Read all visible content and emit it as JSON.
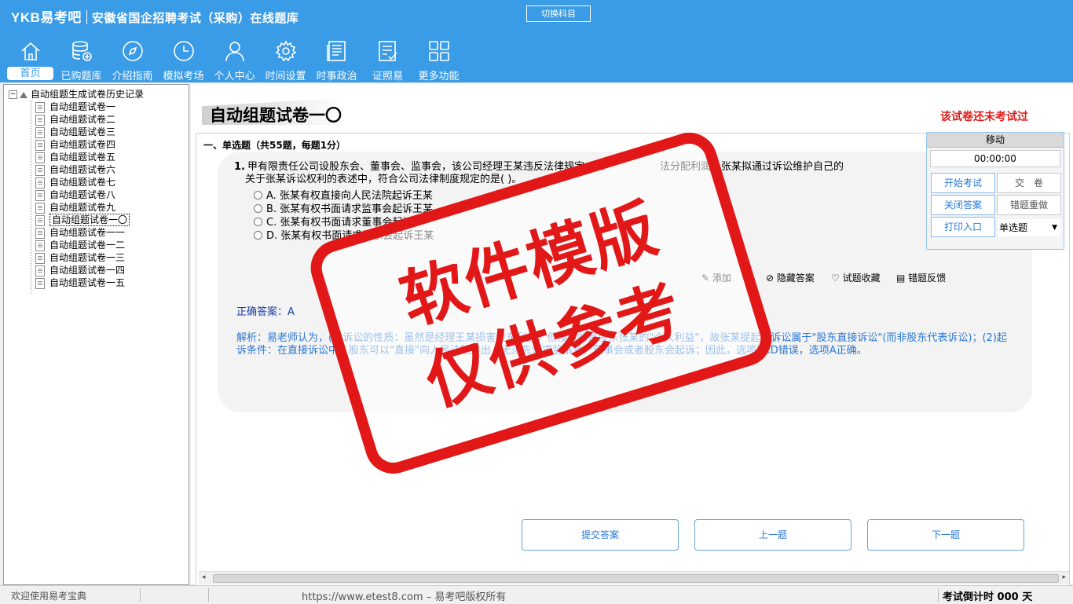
{
  "header": {
    "brand": "YKB易考吧",
    "title": "安徽省国企招聘考试（采购）在线题库",
    "switch_label": "切换科目"
  },
  "nav": [
    {
      "label": "首页",
      "icon": "home-icon"
    },
    {
      "label": "已购题库",
      "icon": "database-icon"
    },
    {
      "label": "介绍指南",
      "icon": "compass-icon"
    },
    {
      "label": "模拟考场",
      "icon": "clock-icon"
    },
    {
      "label": "个人中心",
      "icon": "user-icon"
    },
    {
      "label": "时间设置",
      "icon": "gear-icon"
    },
    {
      "label": "时事政治",
      "icon": "newspaper-icon"
    },
    {
      "label": "证照易",
      "icon": "checklist-icon"
    },
    {
      "label": "更多功能",
      "icon": "grid-icon"
    }
  ],
  "tree": {
    "root": "自动组题生成试卷历史记录",
    "items": [
      "自动组题试卷一",
      "自动组题试卷二",
      "自动组题试卷三",
      "自动组题试卷四",
      "自动组题试卷五",
      "自动组题试卷六",
      "自动组题试卷七",
      "自动组题试卷八",
      "自动组题试卷九",
      "自动组题试卷一〇",
      "自动组题试卷一一",
      "自动组题试卷一二",
      "自动组题试卷一三",
      "自动组题试卷一四",
      "自动组题试卷一五"
    ],
    "selected_index": 9
  },
  "paper": {
    "title": "自动组题试卷一〇",
    "status": "该试卷还未考试过",
    "section": "一、单选题（共55题，每题1分）"
  },
  "question": {
    "number": "1.",
    "text_line1": "甲有限责任公司设股东会、董事会、监事会，该公司经理王某违反法律规定，拒",
    "text_line1b": "法分配利润，张某拟通过诉讼维护自己的",
    "text_line2": "关于张某诉讼权利的表述中，符合公司法律制度规定的是(  )。",
    "options": [
      "A. 张某有权直接向人民法院起诉王某",
      "B. 张某有权书面请求监事会起诉王某",
      "C. 张某有权书面请求董事会起诉",
      "D. 张某有权书面请求股东会起诉王某"
    ]
  },
  "tools": {
    "add_note": "添加",
    "hide_answer": "隐藏答案",
    "favorite": "试题收藏",
    "feedback": "错题反馈"
  },
  "answer": "正确答案：A",
  "analysis": "解析：易老师认为，(1)诉讼的性质：虽然是经理王某损害股东利益，但侵害的是股东张某的\"个人利益\"，故张某提起的诉讼属于\"股东直接诉讼\"(而非股东代表诉讼)；(2)起诉条件：在直接诉讼中，股东可以\"直接\"向人民法院提出，无须先请求监事会、董事会或者股东会起诉；因此，选项BCD错误，选项A正确。",
  "buttons": {
    "submit": "提交答案",
    "prev": "上一题",
    "next": "下一题"
  },
  "float_panel": {
    "move": "移动",
    "timer": "00:00:00",
    "start": "开始考试",
    "hand_in": "交　卷",
    "close_answer": "关闭答案",
    "redo_wrong": "错题重做",
    "print": "打印入口",
    "qtype": "单选题"
  },
  "statusbar": {
    "welcome": "欢迎使用易考宝典",
    "url": "https://www.etest8.com – 易考吧版权所有",
    "countdown": "考试倒计时 000 天"
  },
  "watermark": {
    "line1": "软件模版",
    "line2": "仅供参考"
  },
  "colors": {
    "header_bg": "#3a9be6",
    "accent_red": "#e21818",
    "link_blue": "#2a78d8"
  }
}
